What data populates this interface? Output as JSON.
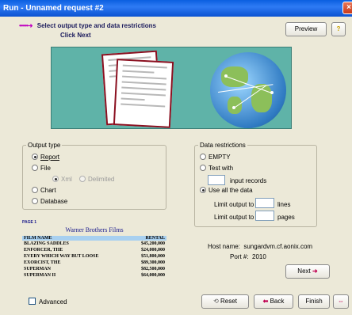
{
  "window": {
    "title": "Run - Unnamed request #2"
  },
  "header": {
    "arrow": "••••••➜",
    "instruction": "Select output type and data restrictions",
    "subinstruction": "Click Next",
    "preview_label": "Preview",
    "help_label": "?"
  },
  "output_type": {
    "legend": "Output type",
    "report": "Report",
    "file": "File",
    "xml": "Xml",
    "delimited": "Delimited",
    "chart": "Chart",
    "database": "Database",
    "selected": "Report"
  },
  "data_restrictions": {
    "legend": "Data restrictions",
    "empty": "EMPTY",
    "test_with": "Test with",
    "input_records": "input records",
    "use_all": "Use all the data",
    "limit_prefix_lines": "Limit output to",
    "lines": "lines",
    "limit_prefix_pages": "Limit output to",
    "pages": "pages",
    "selected": "Use all the data"
  },
  "report_preview": {
    "page": "PAGE 1",
    "title": "Warner Brothers Films",
    "col1": "FILM NAME",
    "col2": "RENTAL",
    "rows": [
      {
        "name": "BLAZING SADDLES",
        "rental": "$45,200,000"
      },
      {
        "name": "ENFORCER, THE",
        "rental": "$24,000,000"
      },
      {
        "name": "EVERY WHICH WAY BUT LOOSE",
        "rental": "$51,800,000"
      },
      {
        "name": "EXORCIST, THE",
        "rental": "$89,300,000"
      },
      {
        "name": "SUPERMAN",
        "rental": "$82,500,000"
      },
      {
        "name": "SUPERMAN II",
        "rental": "$64,000,000"
      }
    ]
  },
  "host": {
    "host_label": "Host name:",
    "host_value": "sungardvm.cf.aonix.com",
    "port_label": "Port #:",
    "port_value": "2010"
  },
  "buttons": {
    "next": "Next",
    "reset": "Reset",
    "back": "Back",
    "finish": "Finish",
    "advanced": "Advanced"
  },
  "colors": {
    "titlebar": "#0A5FE0",
    "accent_arrow": "#C000C0",
    "nav_arrow": "#C00050"
  }
}
